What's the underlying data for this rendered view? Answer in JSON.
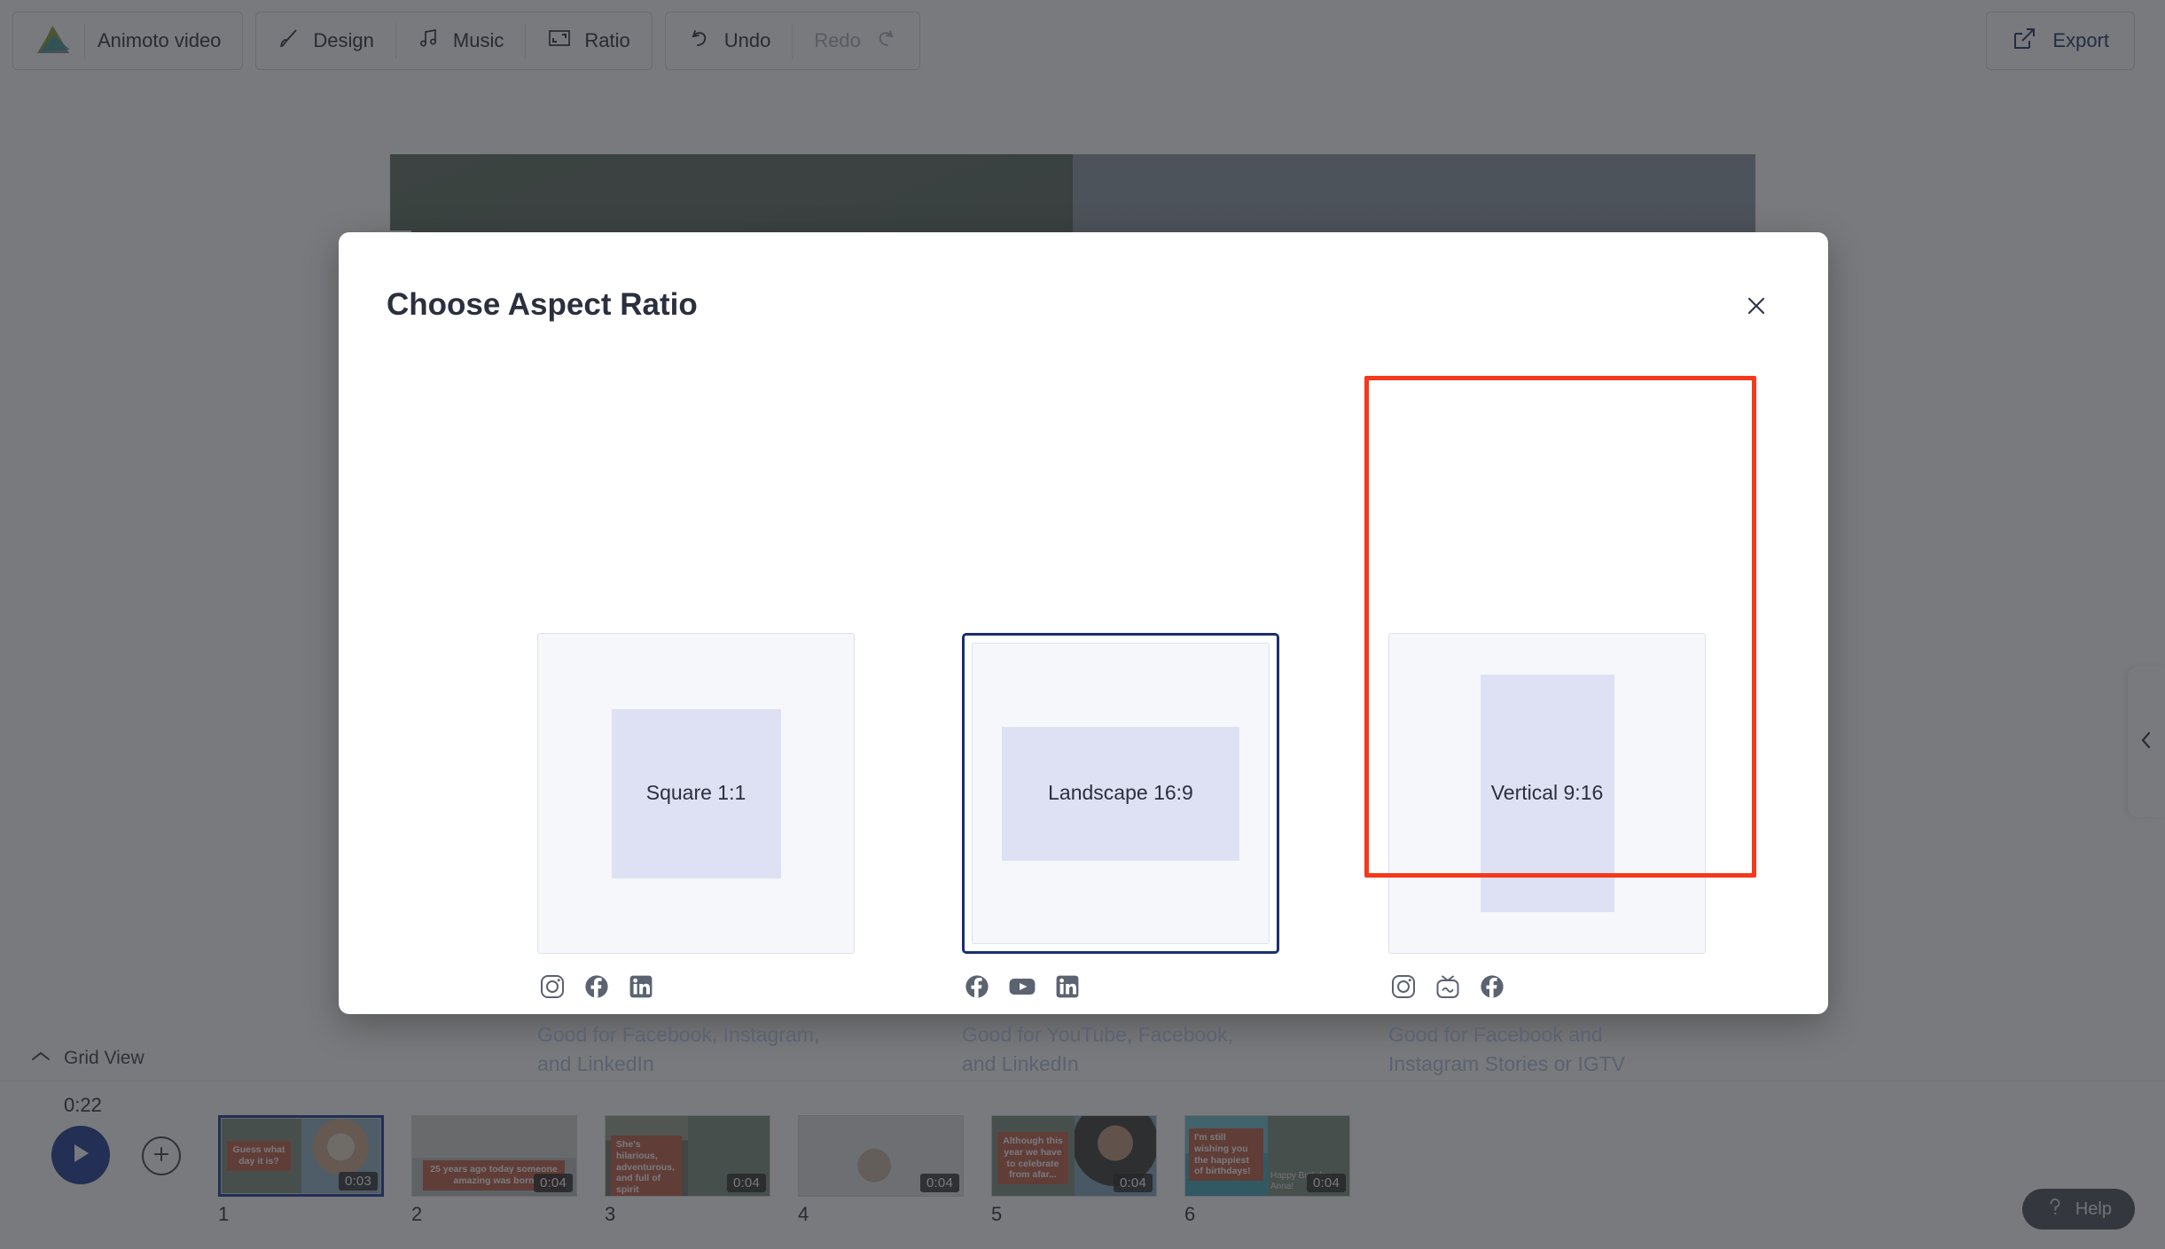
{
  "toolbar": {
    "logo_icon": "animoto-logo-icon",
    "project_title": "Animoto video",
    "design_label": "Design",
    "design_icon": "brush-icon",
    "music_label": "Music",
    "music_icon": "music-note-icon",
    "ratio_label": "Ratio",
    "ratio_icon": "crop-frame-icon",
    "undo_label": "Undo",
    "undo_icon": "undo-arrow-icon",
    "redo_label": "Redo",
    "redo_icon": "redo-arrow-icon",
    "export_label": "Export",
    "export_icon": "export-arrow-icon",
    "export_color": "#1f3268"
  },
  "side_panel": {
    "toggle_icon": "chevron-left-icon"
  },
  "canvas": {
    "tab_icon": "panel-handle-icon"
  },
  "grid_bar": {
    "label": "Grid View",
    "chevron_icon": "chevron-up-icon"
  },
  "timeline": {
    "duration": "0:22",
    "play_icon": "play-icon",
    "add_icon": "plus-icon",
    "clips": [
      {
        "number": "1",
        "duration": "0:03",
        "caption": "Guess what day it is?",
        "selected": true
      },
      {
        "number": "2",
        "duration": "0:04",
        "caption": "25 years ago today someone amazing was born",
        "selected": false
      },
      {
        "number": "3",
        "duration": "0:04",
        "caption": "She's hilarious, adventurous, and full of spirit",
        "selected": false
      },
      {
        "number": "4",
        "duration": "0:04",
        "caption": "",
        "selected": false
      },
      {
        "number": "5",
        "duration": "0:04",
        "caption": "Although this year we have to celebrate from afar...",
        "selected": false
      },
      {
        "number": "6",
        "duration": "0:04",
        "caption": "I'm still wishing you the happiest of birthdays!",
        "subcaption": "Happy Birthday, Anna!",
        "selected": false
      }
    ]
  },
  "help": {
    "label": "Help",
    "icon": "question-mark-icon"
  },
  "modal": {
    "title": "Choose Aspect Ratio",
    "close_icon": "close-icon",
    "selected_accent": "#1b2f6e",
    "annotation_color": "#f4391c",
    "options": [
      {
        "name": "Square 1:1",
        "description": "Good for Facebook, Instagram, and LinkedIn",
        "platform_icons": [
          "instagram-icon",
          "facebook-icon",
          "linkedin-icon"
        ],
        "selected": false,
        "annotated": false
      },
      {
        "name": "Landscape 16:9",
        "description": "Good for YouTube, Facebook, and LinkedIn",
        "platform_icons": [
          "facebook-icon",
          "youtube-icon",
          "linkedin-icon"
        ],
        "selected": true,
        "annotated": false
      },
      {
        "name": "Vertical 9:16",
        "description": "Good for Facebook and Instagram Stories or IGTV",
        "platform_icons": [
          "instagram-icon",
          "igtv-icon",
          "facebook-icon"
        ],
        "selected": false,
        "annotated": true
      }
    ]
  }
}
